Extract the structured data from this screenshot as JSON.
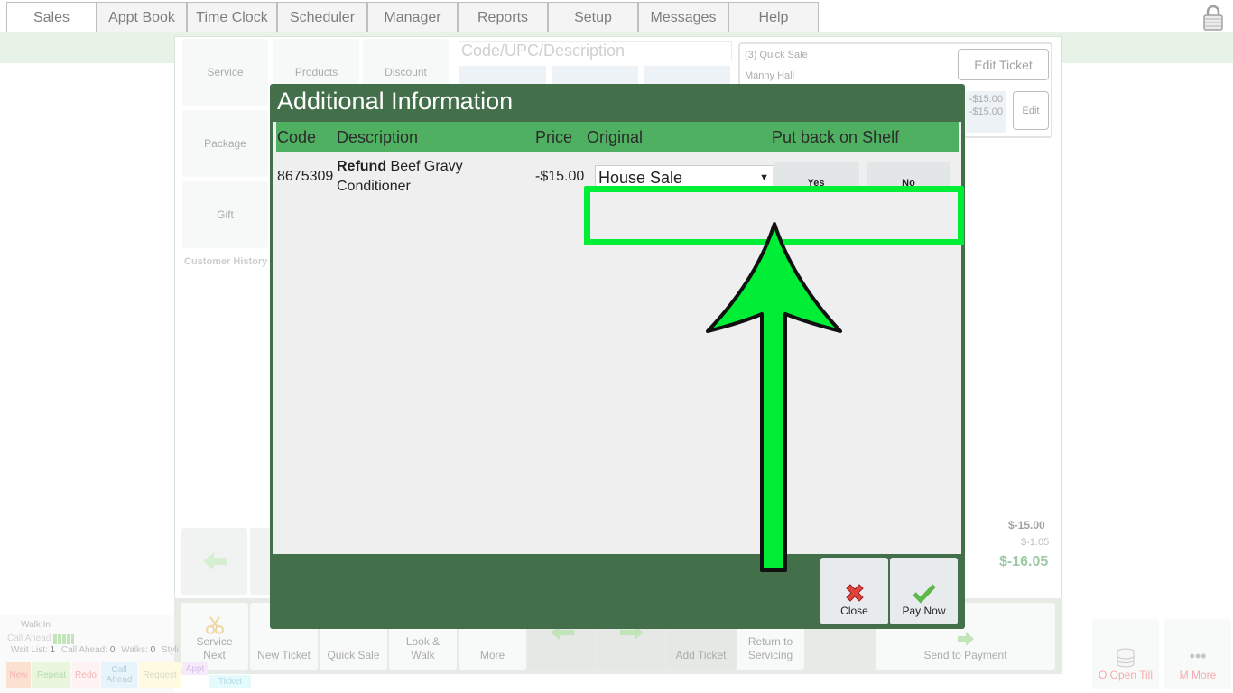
{
  "nav": {
    "tabs": [
      "Sales",
      "Appt Book",
      "Time Clock",
      "Scheduler",
      "Manager",
      "Reports",
      "Setup",
      "Messages",
      "Help"
    ],
    "active_tab": "Sales"
  },
  "categories": {
    "service": "Service",
    "products": "Products",
    "discount": "Discount",
    "package": "Package",
    "gift": "Gift",
    "customer_history": "Customer History"
  },
  "search": {
    "placeholder": "Code/UPC/Description"
  },
  "ticket": {
    "title": "(3) Quick Sale",
    "customer": "Manny Hall",
    "edit_ticket_label": "Edit Ticket",
    "line_amount_1": "-$15.00",
    "line_amount_2": "-$15.00",
    "edit_label": "Edit"
  },
  "totals": {
    "subtotal": "$-15.00",
    "tax": "$-1.05",
    "total": "$-16.05"
  },
  "bottom_buttons": {
    "service_next": "Service Next",
    "new_ticket": "New Ticket",
    "quick_sale": "Quick Sale",
    "look_walk": "Look & Walk",
    "more": "More",
    "add_ticket": "Add Ticket",
    "return_to_servicing": "Return to Servicing",
    "send_to_payment": "Send to Payment",
    "open_till": "O Open Till",
    "m_more": "M More"
  },
  "walkin": {
    "title": "Walk In",
    "call_ahead": "Call Ahead",
    "wait_list_label": "Wait List:",
    "wait_list_count": "1",
    "call_ahead_label": "Call Ahead:",
    "call_ahead_count": "0",
    "walks_label": "Walks:",
    "walks_count": "0",
    "stylist_label": "Styli",
    "tags": [
      "New",
      "Repeat",
      "Redo",
      "Call Ahead",
      "Request",
      "Appt",
      "Ticket"
    ]
  },
  "modal": {
    "title": "Additional Information",
    "columns": {
      "code": "Code",
      "description": "Description",
      "price": "Price",
      "original": "Original",
      "shelf": "Put back on Shelf"
    },
    "row": {
      "code": "8675309",
      "description_bold": "Refund",
      "description_rest": " Beef Gravy",
      "description_line2": "Conditioner",
      "price": "-$15.00",
      "original_selected": "House Sale",
      "yes_label": "Yes",
      "no_label": "No"
    },
    "close_label": "Close",
    "pay_now_label": "Pay Now"
  },
  "colors": {
    "modal_header": "#436f4a",
    "table_header": "#50b062",
    "highlight": "#00ee36",
    "total_green": "#4a9e5c"
  }
}
